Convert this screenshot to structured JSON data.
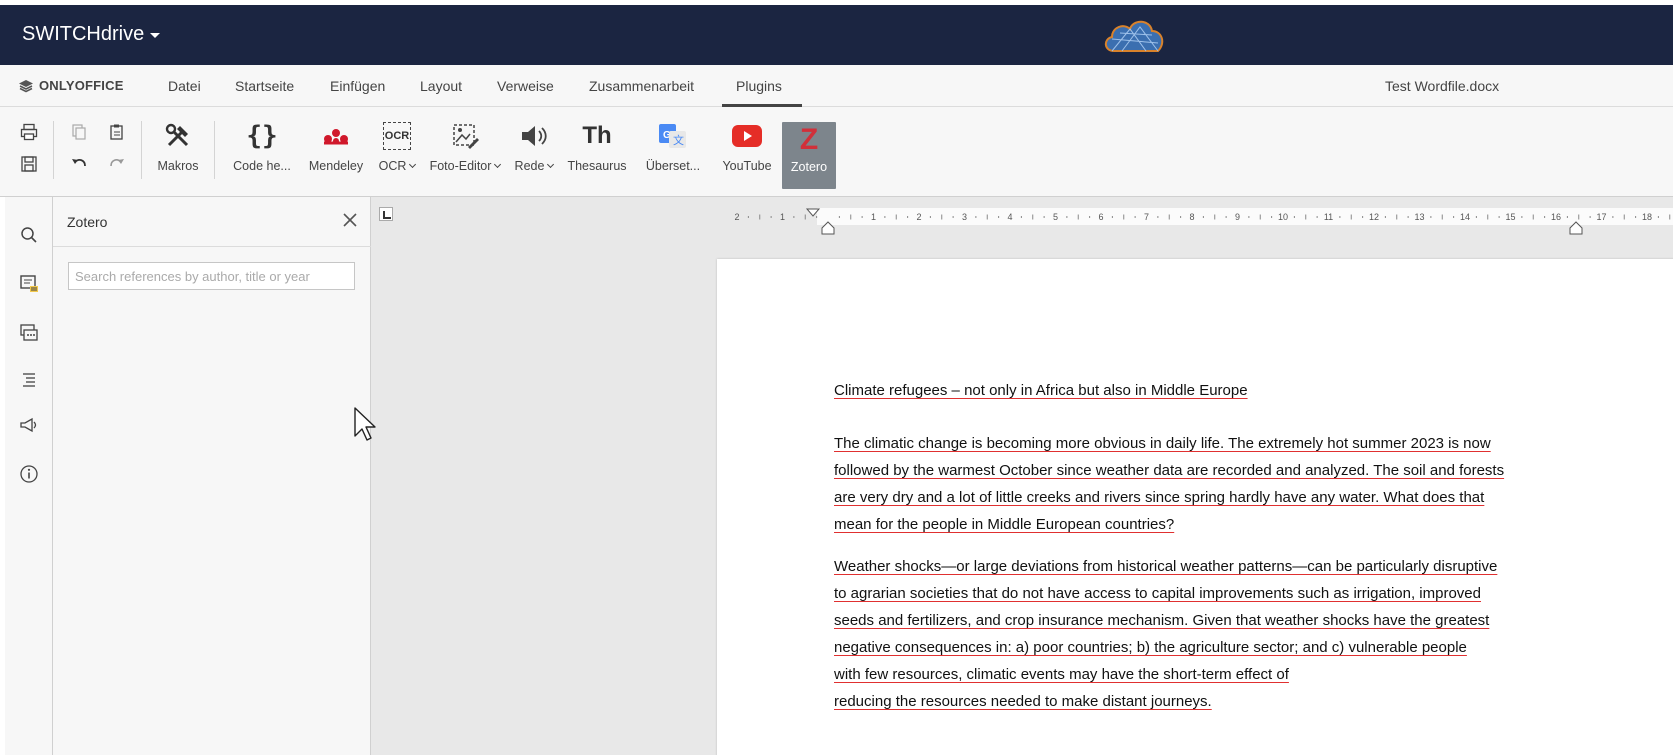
{
  "brand": {
    "name": "SWITCHdrive"
  },
  "menu": {
    "logo": "ONLYOFFICE",
    "items": [
      "Datei",
      "Startseite",
      "Einfügen",
      "Layout",
      "Verweise",
      "Zusammenarbeit",
      "Plugins"
    ],
    "active": "Plugins",
    "doc_title": "Test Wordfile.docx"
  },
  "toolbar": {
    "buttons": [
      {
        "name": "Makros",
        "icon": "wrench-hammer-icon"
      },
      {
        "name": "Code he...",
        "icon": "braces-icon"
      },
      {
        "name": "Mendeley",
        "icon": "mendeley-icon"
      },
      {
        "name": "OCR",
        "icon": "ocr-icon",
        "dropdown": true
      },
      {
        "name": "Foto-Editor",
        "icon": "photo-editor-icon",
        "dropdown": true
      },
      {
        "name": "Rede",
        "icon": "speaker-icon",
        "dropdown": true
      },
      {
        "name": "Thesaurus",
        "icon": "thesaurus-icon"
      },
      {
        "name": "Überset...",
        "icon": "translate-icon"
      },
      {
        "name": "YouTube",
        "icon": "youtube-icon"
      },
      {
        "name": "Zotero",
        "icon": "zotero-icon",
        "selected": true
      }
    ],
    "thesaurus_glyph": "Th",
    "ocr_glyph": "OCR",
    "zotero_glyph": "Z"
  },
  "zotero_panel": {
    "title": "Zotero",
    "search_placeholder": "Search references by author, title or year"
  },
  "ruler": {
    "left_ticks": [
      "2",
      "1"
    ],
    "right_ticks": [
      "1",
      "2",
      "3",
      "4",
      "5",
      "6",
      "7",
      "8",
      "9",
      "10",
      "11",
      "12",
      "13",
      "14",
      "15",
      "16",
      "17",
      "18"
    ]
  },
  "document": {
    "title_line": "Climate refugees – not only in Africa but also in Middle Europe",
    "paragraph1": [
      "The climatic change is becoming more obvious in daily life. The extremely hot summer 2023 is now",
      "followed by the warmest October since weather data are recorded and analyzed. The soil and forests",
      "are very dry and a lot of little creeks and rivers since spring hardly have any water. What does that",
      "mean for the people in Middle European countries?"
    ],
    "paragraph2": [
      "Weather shocks—or large deviations from historical weather patterns—can be particularly disruptive",
      "to agrarian societies that do not have access to capital improvements such as irrigation, improved",
      "seeds and fertilizers, and crop insurance mechanism. Given that weather shocks have the greatest",
      "negative consequences in: a) poor countries; b) the agriculture sector; and c) vulnerable people",
      " with few resources, climatic events may have the short-term effect of",
      " reducing the resources needed to make distant journeys."
    ]
  },
  "colors": {
    "brand_bar": "#1b2541",
    "spell_underline": "#e03030",
    "mendeley": "#d0182b",
    "youtube": "#e52d27",
    "zotero": "#d1303a",
    "selected_btn": "#7d858c"
  }
}
